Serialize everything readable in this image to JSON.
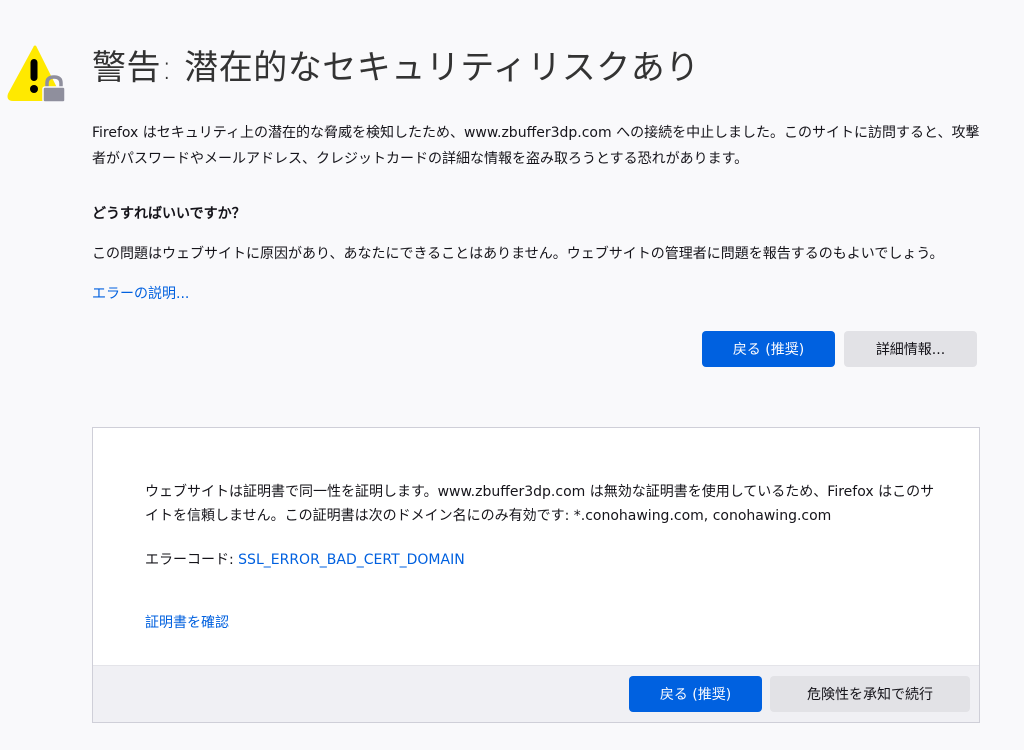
{
  "title": "警告: 潜在的なセキュリティリスクあり",
  "intro": "Firefox はセキュリティ上の潜在的な脅威を検知したため、www.zbuffer3dp.com への接続を中止しました。このサイトに訪問すると、攻撃者がパスワードやメールアドレス、クレジットカードの詳細な情報を盗み取ろうとする恐れがあります。",
  "what_heading": "どうすればいいですか？",
  "what_text": "この問題はウェブサイトに原因があり、あなたにできることはありません。ウェブサイトの管理者に問題を報告するのもよいでしょう。",
  "learn_more": "エラーの説明...",
  "buttons": {
    "back": "戻る (推奨)",
    "advanced": "詳細情報..."
  },
  "advanced": {
    "text": "ウェブサイトは証明書で同一性を証明します。www.zbuffer3dp.com は無効な証明書を使用しているため、Firefox はこのサイトを信頼しません。この証明書は次のドメイン名にのみ有効です: *.conohawing.com, conohawing.com",
    "error_label": "エラーコード: ",
    "error_code": "SSL_ERROR_BAD_CERT_DOMAIN",
    "view_cert": "証明書を確認",
    "back": "戻る (推奨)",
    "accept": "危険性を承知で続行"
  },
  "icons": {
    "warning": "warning-lock-icon"
  },
  "colors": {
    "primary": "#0061e0",
    "link": "#0060df",
    "warning_yellow": "#ffe900"
  }
}
